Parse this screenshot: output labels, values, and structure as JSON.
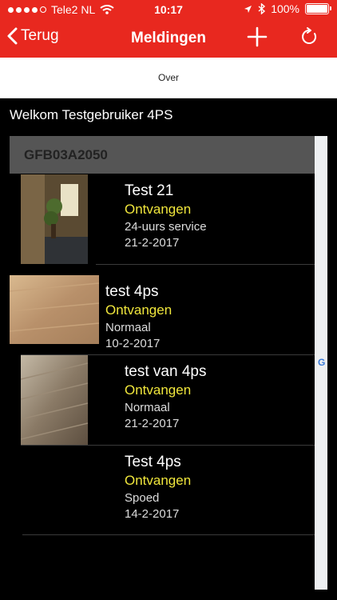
{
  "status_bar": {
    "carrier": "Tele2 NL",
    "time": "10:17",
    "battery": "100%"
  },
  "nav": {
    "back_label": "Terug",
    "title": "Meldingen"
  },
  "subbar": {
    "label": "Over"
  },
  "welcome": "Welkom Testgebruiker 4PS",
  "section": "GFB03A2050",
  "sidebar_letter": "G",
  "items": [
    {
      "title": "Test 21",
      "status": "Ontvangen",
      "type": "24-uurs service",
      "date": "21-2-2017"
    },
    {
      "title": "test 4ps",
      "status": "Ontvangen",
      "type": "Normaal",
      "date": "10-2-2017"
    },
    {
      "title": "test van 4ps",
      "status": "Ontvangen",
      "type": "Normaal",
      "date": "21-2-2017"
    },
    {
      "title": "Test 4ps",
      "status": "Ontvangen",
      "type": "Spoed",
      "date": "14-2-2017"
    }
  ],
  "colors": {
    "header": "#e8281f",
    "status_text": "#f0e63c"
  }
}
